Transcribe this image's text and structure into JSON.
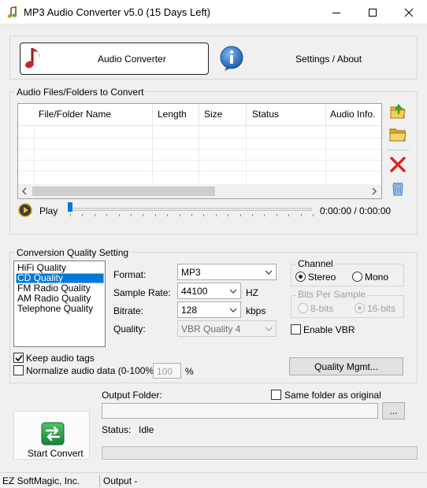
{
  "window": {
    "title": "MP3 Audio Converter v5.0 (15 Days Left)",
    "minimize_icon": "minimize-icon",
    "maximize_icon": "maximize-icon",
    "close_icon": "close-icon"
  },
  "tabs": {
    "audio_converter": "Audio Converter",
    "settings_about": "Settings / About"
  },
  "files_group": {
    "label": "Audio Files/Folders to Convert",
    "columns": [
      "File/Folder Name",
      "Length",
      "Size",
      "Status",
      "Audio Info."
    ]
  },
  "player": {
    "play_label": "Play",
    "time": "0:00:00 / 0:00:00",
    "position": 0
  },
  "quality_group": {
    "label": "Conversion Quality Setting",
    "presets": [
      "HiFi Quality",
      "CD Quality",
      "FM Radio Quality",
      "AM Radio Quality",
      "Telephone Quality"
    ],
    "selected_preset": "CD Quality",
    "format_label": "Format:",
    "format_value": "MP3",
    "sample_rate_label": "Sample Rate:",
    "sample_rate_value": "44100",
    "sample_rate_unit": "HZ",
    "bitrate_label": "Bitrate:",
    "bitrate_value": "128",
    "bitrate_unit": "kbps",
    "quality_label": "Quality:",
    "quality_value": "VBR Quality 4",
    "channel_label": "Channel",
    "stereo_label": "Stereo",
    "mono_label": "Mono",
    "channel_selected": "Stereo",
    "bits_label": "Bits Per Sample",
    "bits_8_label": "8-bits",
    "bits_16_label": "16-bits",
    "bits_selected": "16-bits",
    "enable_vbr_label": "Enable VBR",
    "enable_vbr_checked": false,
    "keep_tags_label": "Keep audio tags",
    "keep_tags_checked": true,
    "normalize_label": "Normalize audio data (0-100%):",
    "normalize_checked": false,
    "normalize_value": "100",
    "normalize_unit": "%",
    "quality_mgmt_label": "Quality Mgmt..."
  },
  "output": {
    "folder_label": "Output Folder:",
    "same_folder_label": "Same folder as original",
    "same_folder_checked": false,
    "folder_value": "",
    "browse_label": "...",
    "status_label": "Status:",
    "status_value": "Idle",
    "start_label": "Start Convert",
    "progress": 0
  },
  "statusbar": {
    "company": "EZ SoftMagic, Inc.",
    "output": "Output -"
  },
  "colors": {
    "selection": "#0078d7",
    "start_green": "#1e9e3a",
    "delete_red": "#d9261c"
  }
}
